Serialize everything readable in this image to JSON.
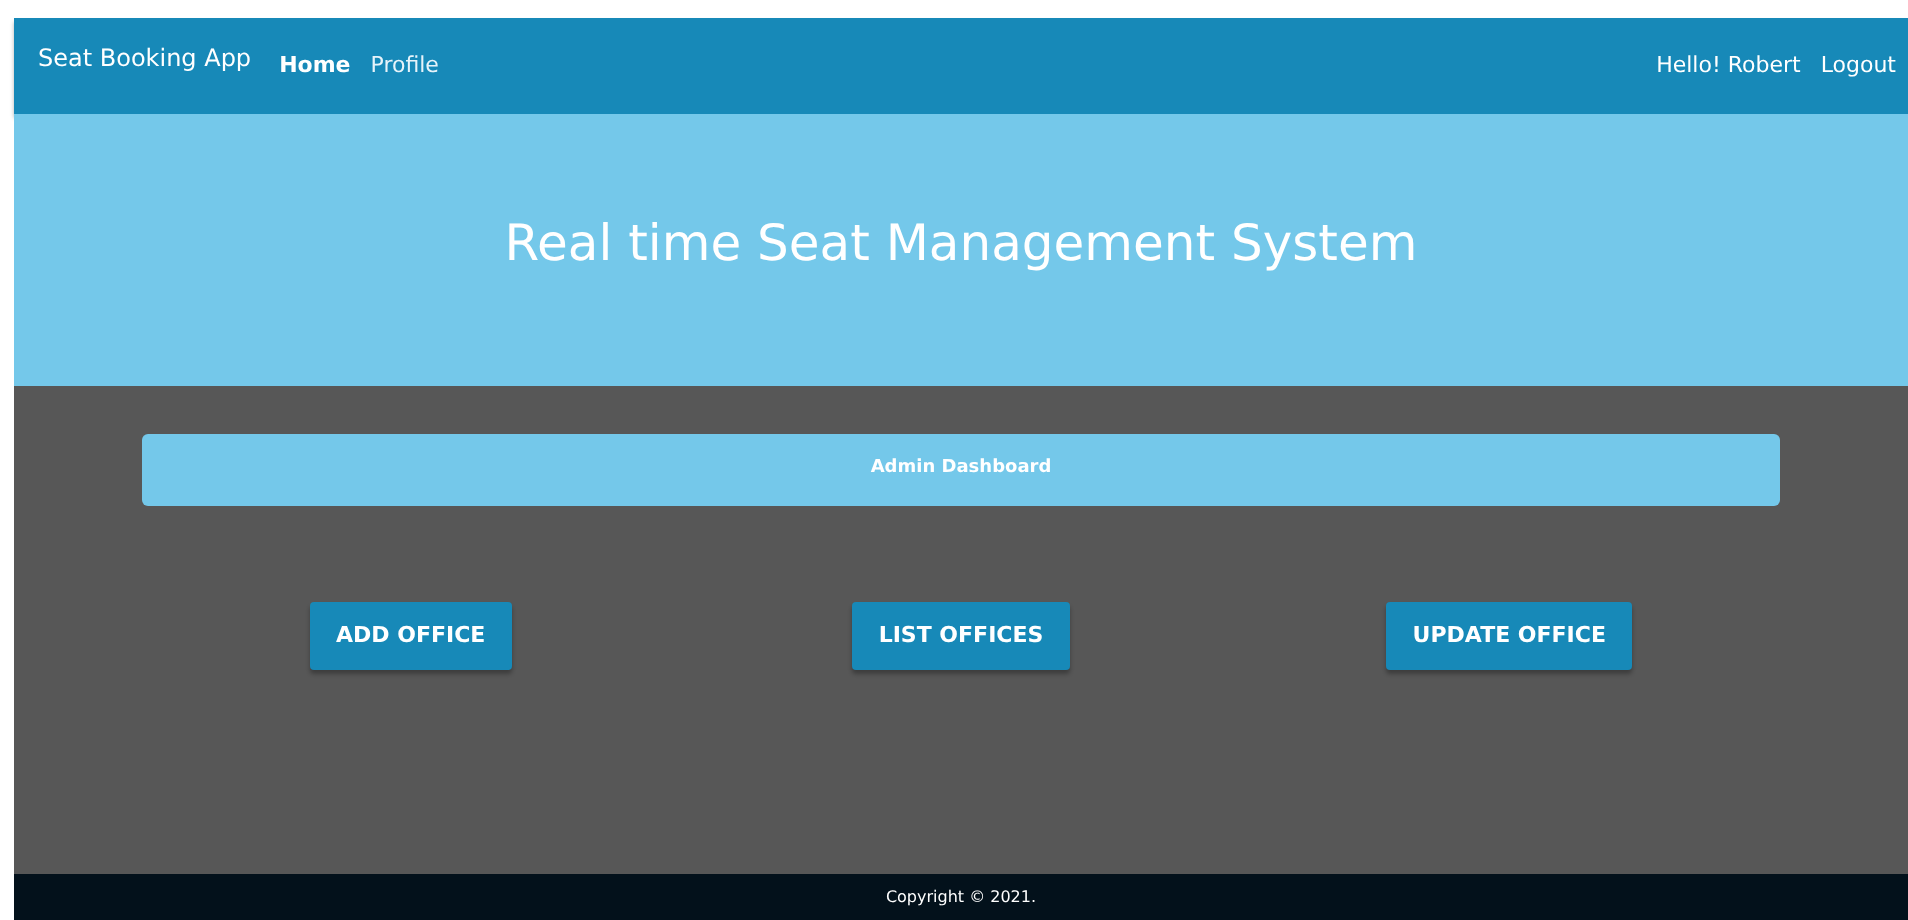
{
  "navbar": {
    "brand": "Seat Booking App",
    "links": [
      {
        "label": "Home",
        "selected": true
      },
      {
        "label": "Profile",
        "selected": false
      }
    ],
    "greeting": "Hello! Robert",
    "logout": "Logout"
  },
  "hero": {
    "title": "Real time Seat Management System"
  },
  "dashboard": {
    "title": "Admin Dashboard",
    "buttons": [
      "ADD OFFICE",
      "LIST OFFICES",
      "UPDATE OFFICE"
    ]
  },
  "footer": {
    "text": "Copyright © 2021."
  }
}
